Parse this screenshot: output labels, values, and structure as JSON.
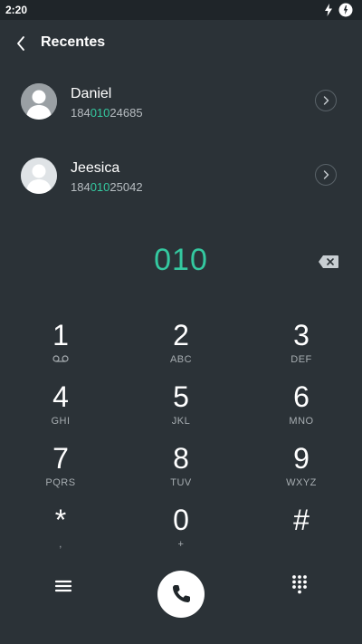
{
  "status": {
    "time": "2:20",
    "icons": [
      "flash-icon",
      "notification-icon"
    ]
  },
  "header": {
    "title": "Recentes",
    "back_icon": "chevron-left-icon"
  },
  "recents": [
    {
      "name": "Daniel",
      "number_prefix": "184",
      "number_match": "010",
      "number_suffix": "24685",
      "icon": "chevron-right-icon"
    },
    {
      "name": "Jeesica",
      "number_prefix": "184",
      "number_match": "010",
      "number_suffix": "25042",
      "icon": "chevron-right-icon"
    }
  ],
  "dial": {
    "number": "010",
    "backspace_icon": "backspace-icon"
  },
  "keypad": [
    {
      "digit": "1",
      "letters": "",
      "sub_icon": "voicemail-icon"
    },
    {
      "digit": "2",
      "letters": "ABC"
    },
    {
      "digit": "3",
      "letters": "DEF"
    },
    {
      "digit": "4",
      "letters": "GHI"
    },
    {
      "digit": "5",
      "letters": "JKL"
    },
    {
      "digit": "6",
      "letters": "MNO"
    },
    {
      "digit": "7",
      "letters": "PQRS"
    },
    {
      "digit": "8",
      "letters": "TUV"
    },
    {
      "digit": "9",
      "letters": "WXYZ"
    },
    {
      "digit": "*",
      "letters": ","
    },
    {
      "digit": "0",
      "letters": "+"
    },
    {
      "digit": "#",
      "letters": ""
    }
  ],
  "bottom_bar": {
    "menu_icon": "menu-icon",
    "call_icon": "phone-icon",
    "keypad_icon": "dialpad-icon"
  },
  "colors": {
    "background": "#2b3237",
    "accent": "#34c9a0",
    "text": "#ffffff",
    "secondary_text": "#a7adb1"
  }
}
